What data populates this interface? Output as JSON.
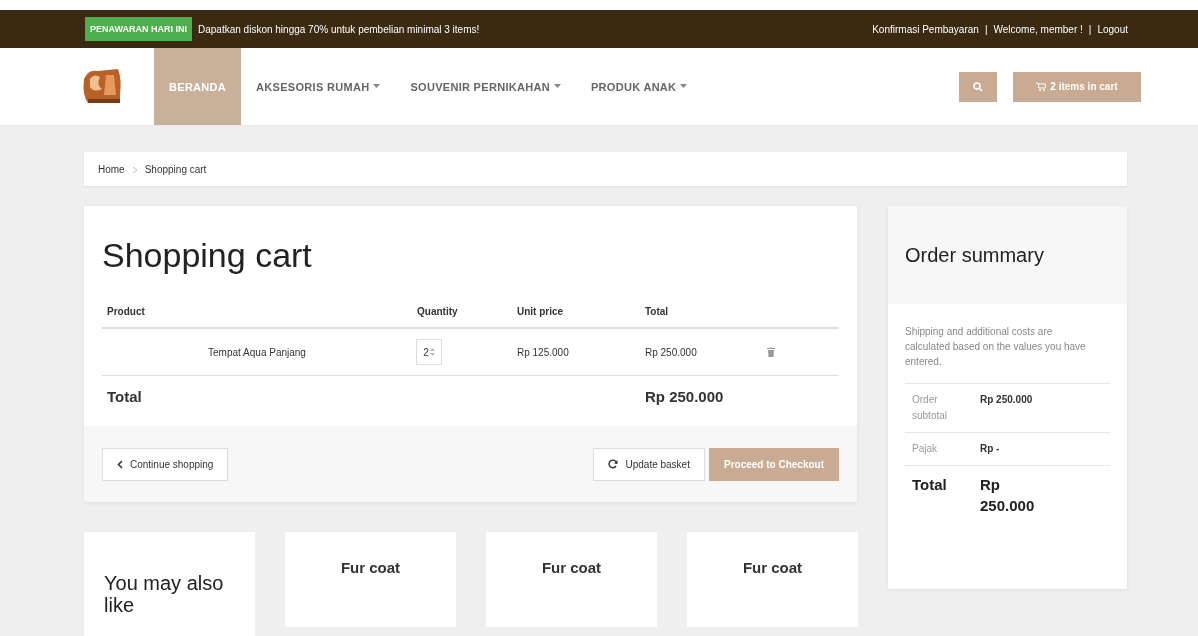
{
  "promo": {
    "badge": "PENAWARAN HARI INI",
    "text": "Dapatkan diskon hingga 70% untuk pembelian minimal 3 items!"
  },
  "top_links": [
    "Konfirmasi Pembayaran",
    "|",
    "Welcome, member !",
    "|",
    "Logout"
  ],
  "nav": [
    {
      "label": "BERANDA",
      "selected": true,
      "dropdown": false
    },
    {
      "label": "AKSESORIS RUMAH",
      "selected": false,
      "dropdown": true
    },
    {
      "label": "SOUVENIR PERNIKAHAN",
      "selected": false,
      "dropdown": true
    },
    {
      "label": "PRODUK ANAK",
      "selected": false,
      "dropdown": true
    }
  ],
  "cart_button": "2 items in cart",
  "breadcrumb": [
    "Home",
    "Shopping cart"
  ],
  "cart": {
    "title": "Shopping cart",
    "columns": [
      "Product",
      "Quantity",
      "Unit price",
      "Total"
    ],
    "rows": [
      {
        "product": "Tempat Aqua Panjang",
        "quantity": "2",
        "unit_price": "Rp 125.000",
        "total": "Rp 250.000"
      }
    ],
    "total_label": "Total",
    "total_value": "Rp 250.000",
    "continue": "Continue shopping",
    "update": "Update basket",
    "checkout": "Proceed to Checkout"
  },
  "summary": {
    "title": "Order summary",
    "note": "Shipping and additional costs are calculated based on the values you have entered.",
    "rows": [
      {
        "label": "Order subtotal",
        "value": "Rp 250.000",
        "kind": "line"
      },
      {
        "label": "Pajak",
        "value": "Rp -",
        "kind": "line"
      },
      {
        "label": "Total",
        "value": "Rp 250.000",
        "kind": "total"
      }
    ]
  },
  "also_like": {
    "title": "You may also like",
    "products": [
      "Fur coat",
      "Fur coat",
      "Fur coat"
    ]
  }
}
